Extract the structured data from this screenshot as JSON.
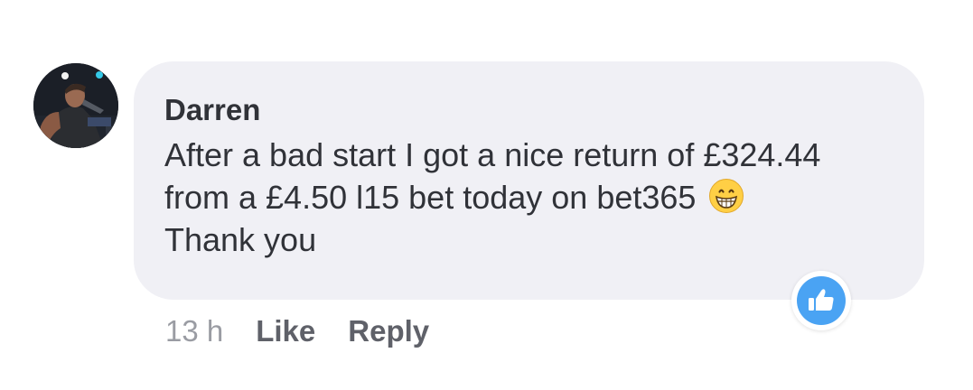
{
  "comment": {
    "author": "Darren",
    "lines": [
      "After a bad start I got a nice return of £324.44",
      "from a £4.50 l15 bet today on bet365",
      "Thank you"
    ],
    "emoji": "grinning-face-with-smiling-eyes",
    "reaction": "like",
    "timestamp": "13 h",
    "like_label": "Like",
    "reply_label": "Reply"
  },
  "colors": {
    "bubble": "#f0f0f5",
    "text": "#303238",
    "meta": "#9a9ca3",
    "action": "#5f6169",
    "like_badge": "#4aa3f3"
  }
}
